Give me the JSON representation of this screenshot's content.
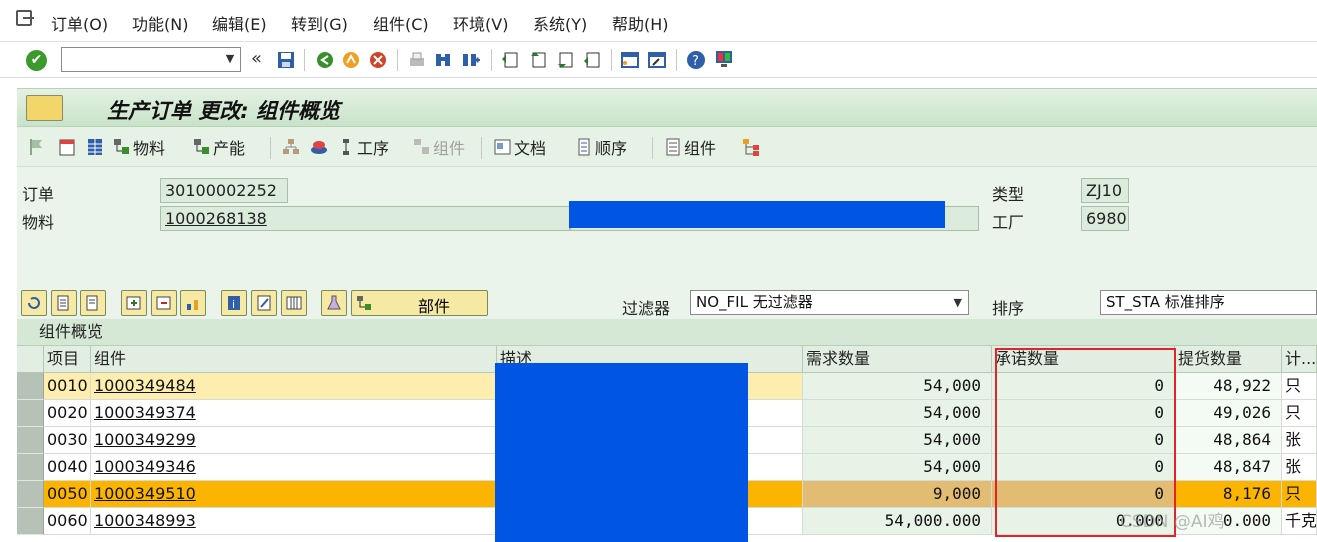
{
  "menu": [
    "订单(O)",
    "功能(N)",
    "编辑(E)",
    "转到(G)",
    "组件(C)",
    "环境(V)",
    "系统(Y)",
    "帮助(H)"
  ],
  "toolbar": {
    "command_value": "",
    "back_glyph": "«"
  },
  "title": "生产订单 更改: 组件概览",
  "app_toolbar": {
    "material": "物料",
    "capacity": "产能",
    "operation": "工序",
    "component_disabled": "组件",
    "document": "文档",
    "sequence": "顺序",
    "component": "组件"
  },
  "header": {
    "order_label": "订单",
    "order_value": "30100002252",
    "material_label": "物料",
    "material_value": "1000268138",
    "type_label": "类型",
    "type_value": "ZJ10",
    "plant_label": "工厂",
    "plant_value": "6980"
  },
  "grid_toolbar": {
    "parts_button": "部件",
    "filter_label": "过滤器",
    "filter_value": "NO_FIL 无过滤器",
    "sort_label": "排序",
    "sort_value": "ST_STA 标准排序"
  },
  "grid": {
    "title": "组件概览",
    "columns": [
      "项目",
      "组件",
      "描述",
      "需求数量",
      "承诺数量",
      "提货数量",
      "计..."
    ],
    "rows": [
      {
        "item": "0010",
        "component": "1000349484",
        "desc": "",
        "req": "54,000",
        "commit": "0",
        "pick": "48,922",
        "unit": "只"
      },
      {
        "item": "0020",
        "component": "1000349374",
        "desc": "",
        "req": "54,000",
        "commit": "0",
        "pick": "49,026",
        "unit": "只"
      },
      {
        "item": "0030",
        "component": "1000349299",
        "desc": "",
        "req": "54,000",
        "commit": "0",
        "pick": "48,864",
        "unit": "张"
      },
      {
        "item": "0040",
        "component": "1000349346",
        "desc": "",
        "req": "54,000",
        "commit": "0",
        "pick": "48,847",
        "unit": "张"
      },
      {
        "item": "0050",
        "component": "1000349510",
        "desc": "",
        "req": "9,000",
        "commit": "0",
        "pick": "8,176",
        "unit": "只"
      },
      {
        "item": "0060",
        "component": "1000348993",
        "desc": "",
        "req": "54,000.000",
        "commit": "0.000",
        "pick": "0.000",
        "unit": "千克"
      }
    ]
  },
  "watermark": "CSDN @AI鸡",
  "colors": {
    "accent_green": "#3b9a2c",
    "highlight_orange": "#fbb500",
    "selected_yellow": "#fdeeb0",
    "redact_blue": "#0055e3",
    "red_box": "#e0242a"
  }
}
